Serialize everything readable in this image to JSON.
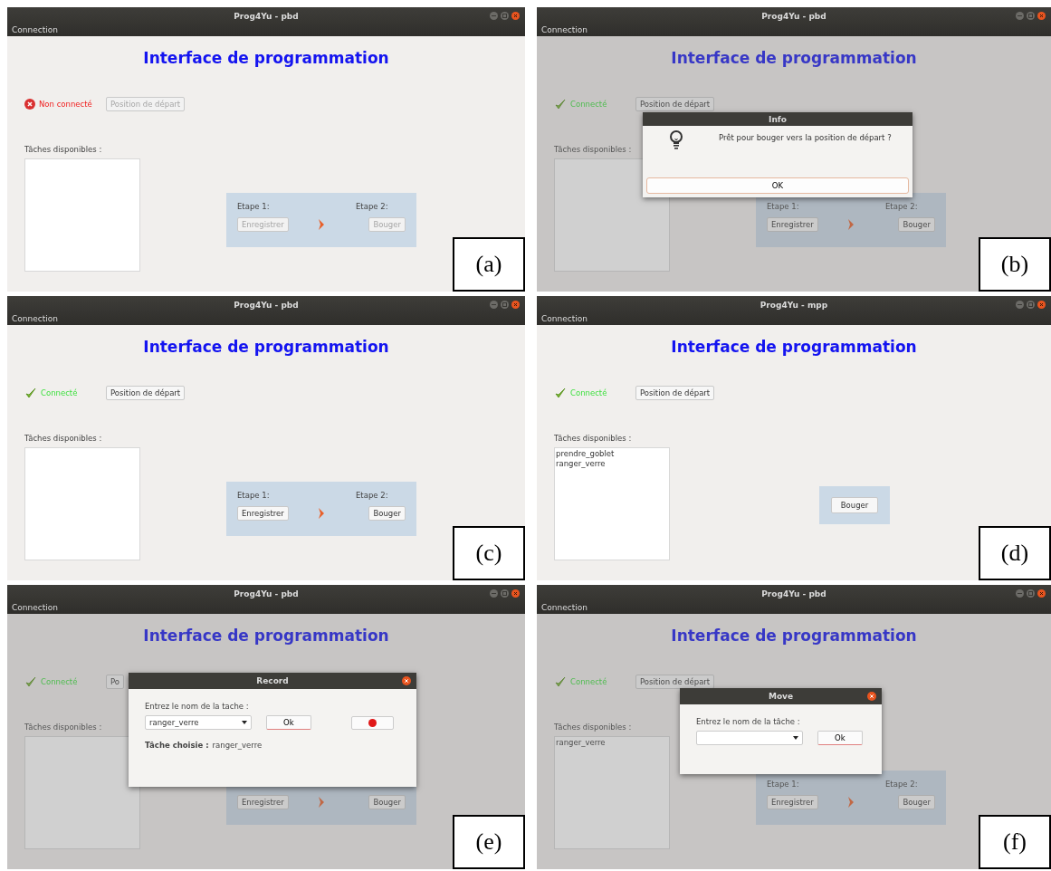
{
  "panels": [
    {
      "label": "(a)",
      "window_title": "Prog4Yu - pbd",
      "menu": [
        "Connection"
      ],
      "heading": "Interface de programmation",
      "status": {
        "connected": false,
        "text": "Non connecté"
      },
      "start_button": {
        "label": "Position de départ",
        "disabled": true
      },
      "tasks": {
        "label": "Tâches disponibles :"
      },
      "steps": {
        "kind": "two_step",
        "step1_label": "Etape 1:",
        "record_button": {
          "label": "Enregistrer",
          "disabled": true
        },
        "step2_label": "Etape 2:",
        "move_button": {
          "label": "Bouger",
          "disabled": true
        }
      }
    },
    {
      "label": "(b)",
      "window_title": "Prog4Yu - pbd",
      "menu": [
        "Connection"
      ],
      "heading": "Interface de programmation",
      "status": {
        "connected": true,
        "text": "Connecté"
      },
      "start_button": {
        "label": "Position de départ",
        "disabled": false
      },
      "tasks": {
        "label": "Tâches disponibles :"
      },
      "steps": {
        "kind": "two_step",
        "step1_label": "Etape 1:",
        "record_button": {
          "label": "Enregistrer",
          "disabled": false
        },
        "step2_label": "Etape 2:",
        "move_button": {
          "label": "Bouger",
          "disabled": false
        }
      },
      "dialog": {
        "kind": "info",
        "title": "Info",
        "message": "Prêt pour bouger vers la position de départ ?",
        "ok_button": "OK"
      }
    },
    {
      "label": "(c)",
      "window_title": "Prog4Yu - pbd",
      "menu": [
        "Connection"
      ],
      "heading": "Interface de programmation",
      "status": {
        "connected": true,
        "text": "Connecté"
      },
      "start_button": {
        "label": "Position de départ",
        "disabled": false
      },
      "tasks": {
        "label": "Tâches disponibles :"
      },
      "steps": {
        "kind": "two_step",
        "step1_label": "Etape 1:",
        "record_button": {
          "label": "Enregistrer",
          "disabled": false
        },
        "step2_label": "Etape 2:",
        "move_button": {
          "label": "Bouger",
          "disabled": false
        }
      }
    },
    {
      "label": "(d)",
      "window_title": "Prog4Yu - mpp",
      "menu": [
        "Connection"
      ],
      "heading": "Interface de programmation",
      "status": {
        "connected": true,
        "text": "Connecté"
      },
      "start_button": {
        "label": "Position de départ",
        "disabled": false
      },
      "tasks": {
        "label": "Tâches disponibles :",
        "items": [
          "prendre_goblet",
          "ranger_verre"
        ]
      },
      "steps": {
        "kind": "single",
        "move_button": {
          "label": "Bouger",
          "disabled": false
        }
      }
    },
    {
      "label": "(e)",
      "window_title": "Prog4Yu - pbd",
      "menu": [
        "Connection"
      ],
      "heading": "Interface de programmation",
      "status": {
        "connected": true,
        "text": "Connecté"
      },
      "start_button": {
        "label": "Po",
        "disabled": false
      },
      "tasks": {
        "label": "Tâches disponibles :"
      },
      "steps": {
        "kind": "two_step",
        "record_button": {
          "label": "Enregistrer",
          "disabled": false
        },
        "move_button": {
          "label": "Bouger",
          "disabled": false
        }
      },
      "dialog": {
        "kind": "record",
        "title": "Record",
        "prompt": "Entrez le nom de la tache :",
        "combo_value": "ranger_verre",
        "ok_button": "Ok",
        "chosen_label": "Tâche choisie :",
        "chosen_value": "ranger_verre"
      }
    },
    {
      "label": "(f)",
      "window_title": "Prog4Yu - pbd",
      "menu": [
        "Connection"
      ],
      "heading": "Interface de programmation",
      "status": {
        "connected": true,
        "text": "Connecté"
      },
      "start_button": {
        "label": "Position de départ",
        "disabled": false
      },
      "tasks": {
        "label": "Tâches disponibles :",
        "items": [
          "ranger_verre"
        ]
      },
      "steps": {
        "kind": "two_step",
        "step1_label": "Etape 1:",
        "record_button": {
          "label": "Enregistrer",
          "disabled": false
        },
        "step2_label": "Etape 2:",
        "move_button": {
          "label": "Bouger",
          "disabled": false
        }
      },
      "dialog": {
        "kind": "move",
        "title": "Move",
        "prompt": "Entrez le nom de la tâche :",
        "ok_button": "Ok"
      }
    }
  ]
}
